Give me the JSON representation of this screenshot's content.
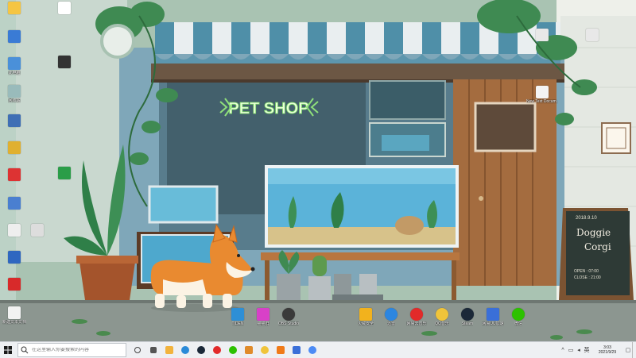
{
  "shop_sign": "PET SHOP",
  "chalkboard": {
    "date": "2018.9.10",
    "line1": "Doggie",
    "line2": "Corgi",
    "open": "OPEN : 07:00",
    "close": "CLOSE : 21:00"
  },
  "desktop_icons_left": [
    {
      "label": "",
      "color": "#f5c542"
    },
    {
      "label": "",
      "color": "#3a7bd5"
    },
    {
      "label": "此电脑",
      "color": "#4a90d9"
    },
    {
      "label": "回收站",
      "color": "#9bb"
    },
    {
      "label": "",
      "color": "#3f6fb5"
    },
    {
      "label": "",
      "color": "#e0b030"
    },
    {
      "label": "",
      "color": "#d33"
    },
    {
      "label": "",
      "color": "#4a7fd0"
    },
    {
      "label": "",
      "color": "#eee"
    },
    {
      "label": "",
      "color": "#2f67c0"
    },
    {
      "label": "",
      "color": "#d82a2a"
    },
    {
      "label": "新建文本文档",
      "color": "#f2f2f2"
    }
  ],
  "desktop_icons_col2": [
    {
      "label": "",
      "color": "#fff"
    },
    {
      "label": "",
      "color": "#333"
    },
    {
      "label": "",
      "color": "#2a9d48"
    },
    {
      "label": "",
      "color": "#ddd"
    }
  ],
  "desktop_icons_right": [
    {
      "label": "",
      "color": "#e8e8e8"
    },
    {
      "label": "",
      "color": "#e8e8e8"
    },
    {
      "label": "New Text Docum...",
      "color": "#f4f4f4"
    }
  ],
  "dock_icons_left": [
    {
      "label": "TIDEN",
      "color": "#2e8fd6"
    },
    {
      "label": "喵喵群",
      "color": "#d840c8"
    },
    {
      "label": "OBS Studio",
      "color": "#3a3a3a"
    }
  ],
  "dock_icons_right": [
    {
      "label": "火绒安全",
      "color": "#f2b21d"
    },
    {
      "label": "迅雷",
      "color": "#2c86e0"
    },
    {
      "label": "网易云音乐",
      "color": "#e22a2a"
    },
    {
      "label": "QQ音乐",
      "color": "#f0c43a"
    },
    {
      "label": "Steam",
      "color": "#1b2838"
    },
    {
      "label": "网易UU加速",
      "color": "#3a6fd8"
    },
    {
      "label": "微信",
      "color": "#2dc100"
    }
  ],
  "search": {
    "placeholder": "在这里输入你要搜索的内容"
  },
  "taskbar_apps": [
    {
      "name": "task-view",
      "color": "#555"
    },
    {
      "name": "explorer",
      "color": "#f2b33d"
    },
    {
      "name": "edge",
      "color": "#2a8ad8"
    },
    {
      "name": "steam",
      "color": "#1b2838"
    },
    {
      "name": "netease-music",
      "color": "#e22a2a"
    },
    {
      "name": "wechat",
      "color": "#2dc100"
    },
    {
      "name": "shield",
      "color": "#e08b2a"
    },
    {
      "name": "qq-music",
      "color": "#f0c43a"
    },
    {
      "name": "app-orange",
      "color": "#f07a18"
    },
    {
      "name": "app-blue",
      "color": "#3a6fd8"
    },
    {
      "name": "chrome",
      "color": "#4c8bf5"
    }
  ],
  "clock": {
    "time": "3:03",
    "date": "2021/9/29"
  },
  "tray": {
    "chevron": "^",
    "lang": "英"
  }
}
